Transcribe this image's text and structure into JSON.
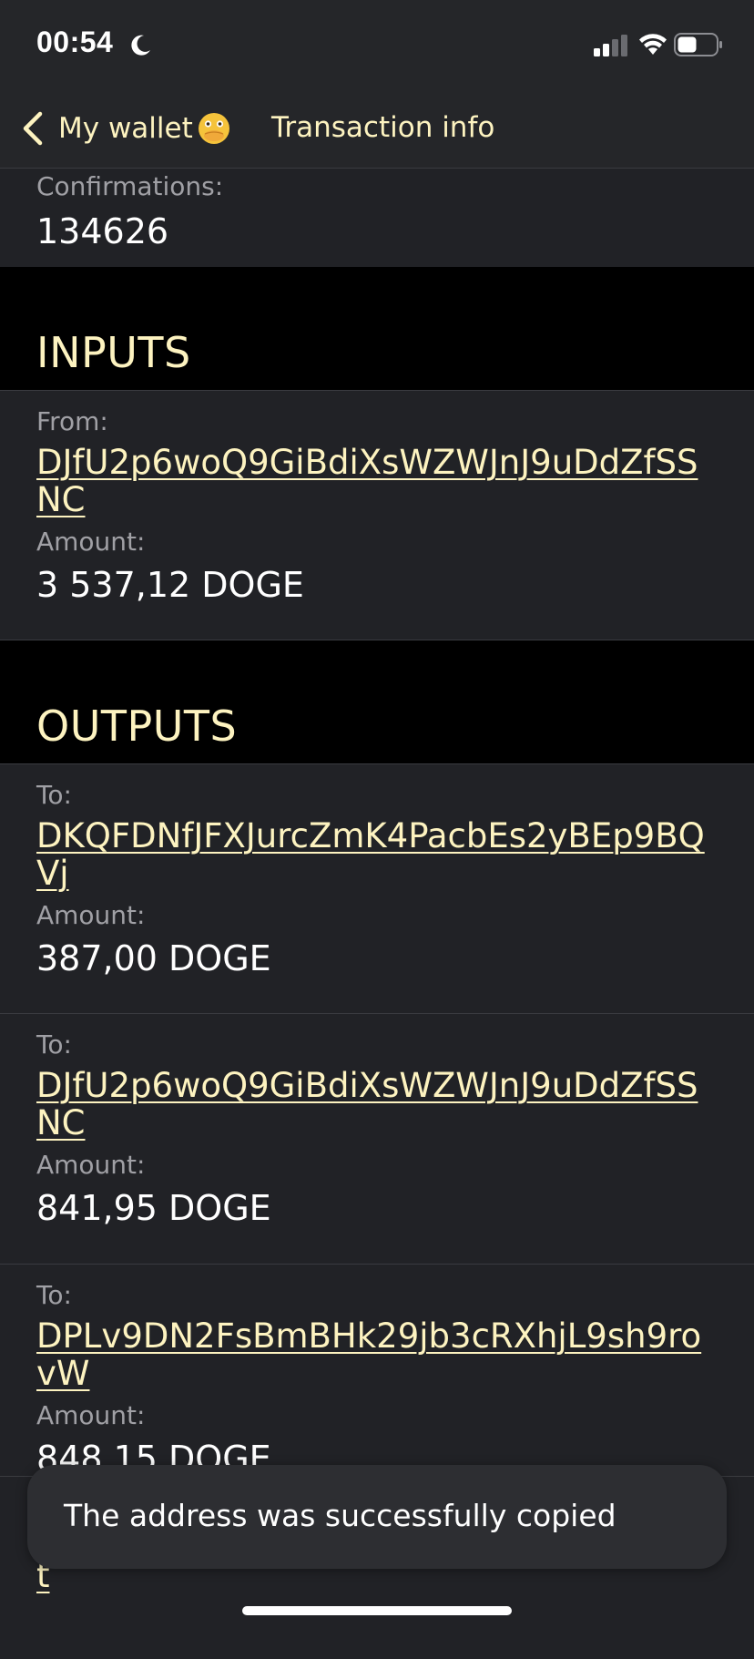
{
  "status_bar": {
    "time": "00:54",
    "icons": [
      "moon-icon",
      "signal-icon",
      "wifi-icon",
      "battery-icon"
    ]
  },
  "nav": {
    "back_label": "My wallet",
    "back_emoji_icon": "face-with-open-eyes-and-hand-over-mouth-icon",
    "title": "Transaction info"
  },
  "confirmations": {
    "label": "Confirmations:",
    "value": "134626"
  },
  "inputs": {
    "title": "INPUTS",
    "items": [
      {
        "from_label": "From:",
        "address": "DJfU2p6woQ9GiBdiXsWZWJnJ9uDdZfSSNC",
        "amount_label": "Amount:",
        "amount": "3 537,12 DOGE"
      }
    ]
  },
  "outputs": {
    "title": "OUTPUTS",
    "items": [
      {
        "to_label": "To:",
        "address": "DKQFDNfJFXJurcZmK4PacbEs2yBEp9BQVj",
        "amount_label": "Amount:",
        "amount": "387,00 DOGE"
      },
      {
        "to_label": "To:",
        "address": "DJfU2p6woQ9GiBdiXsWZWJnJ9uDdZfSSNC",
        "amount_label": "Amount:",
        "amount": "841,95 DOGE"
      },
      {
        "to_label": "To:",
        "address": "DPLv9DN2FsBmBHk29jb3cRXhjL9sh9rovW",
        "amount_label": "Amount:",
        "amount": "848,15 DOGE"
      }
    ],
    "partial_address_tail": "t"
  },
  "toast": {
    "message": "The address was successfully copied"
  },
  "colors": {
    "accent": "#fdf3c0",
    "card_bg": "#212226",
    "header_bg": "#000000",
    "bar_bg": "#252629",
    "label_gray": "#a0a0a5"
  }
}
